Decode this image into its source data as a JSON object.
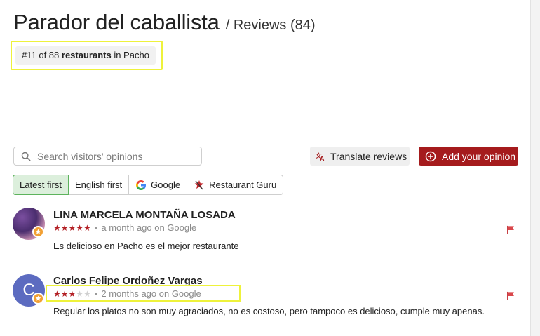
{
  "header": {
    "title": "Parador del caballista",
    "subtitle": "/ Reviews (84)",
    "rank_prefix": "#11 of 88",
    "rank_bold": "restaurants",
    "rank_suffix": "in Pacho"
  },
  "toolbar": {
    "search_placeholder": "Search visitors’ opinions",
    "translate_label": "Translate reviews",
    "add_label": "Add your opinion"
  },
  "filters": [
    {
      "label": "Latest first",
      "active": true
    },
    {
      "label": "English first",
      "active": false
    },
    {
      "label": "Google",
      "active": false,
      "icon": "google-icon"
    },
    {
      "label": "Restaurant Guru",
      "active": false,
      "icon": "restaurant-guru-icon"
    }
  ],
  "reviews": [
    {
      "name": "LINA MARCELA MONTAÑA LOSADA",
      "rating": 5,
      "stars_on": "★★★★★",
      "stars_off": "",
      "time": "a month ago on Google",
      "text": "Es delicioso en Pacho es el mejor restaurante",
      "avatar": "photo"
    },
    {
      "name": "Carlos Felipe Ordoñez Vargas",
      "rating": 3,
      "stars_on": "★★★",
      "stars_off": "★★",
      "time": "2 months ago on Google",
      "text": "Regular los platos no son muy agraciados, no es costoso, pero tampoco es delicioso, cumple muy apenas.",
      "avatar_letter": "C"
    }
  ],
  "colors": {
    "accent_red": "#a51b1d",
    "star_red": "#b32025",
    "active_filter_bg": "#dcefdc",
    "active_filter_border": "#5db35d",
    "highlight_yellow": "#eef23b"
  }
}
